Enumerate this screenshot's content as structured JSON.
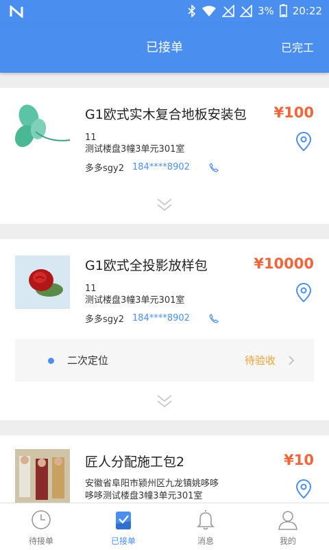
{
  "status_bar": {
    "battery": "3%",
    "time": "20:22"
  },
  "header": {
    "title": "已接单",
    "action": "已完工"
  },
  "colors": {
    "brand": "#4a8ff0",
    "price": "#f0663a",
    "pending": "#f0a030"
  },
  "orders": [
    {
      "title": "G1欧式实木复合地板安装包",
      "price": "¥100",
      "line1": "11",
      "line2": "测试楼盘3幢3单元301室",
      "contact_name": "多多sgy2",
      "contact_phone": "184****8902"
    },
    {
      "title": "G1欧式全投影放样包",
      "price": "¥10000",
      "line1": "11",
      "line2": "测试楼盘3幢3单元301室",
      "contact_name": "多多sgy2",
      "contact_phone": "184****8902",
      "sub_status": {
        "label": "二次定位",
        "state": "待验收"
      }
    },
    {
      "title": "匠人分配施工包2",
      "price": "¥10",
      "line1": "安徽省阜阳市颍州区九龙镇姚哆哆",
      "line2": "哆哆测试楼盘3幢3单元301室"
    }
  ],
  "tabs": [
    {
      "label": "待接单",
      "icon": "clock-icon"
    },
    {
      "label": "已接单",
      "icon": "clipboard-check-icon",
      "active": true
    },
    {
      "label": "消息",
      "icon": "bell-icon"
    },
    {
      "label": "我的",
      "icon": "user-icon"
    }
  ]
}
